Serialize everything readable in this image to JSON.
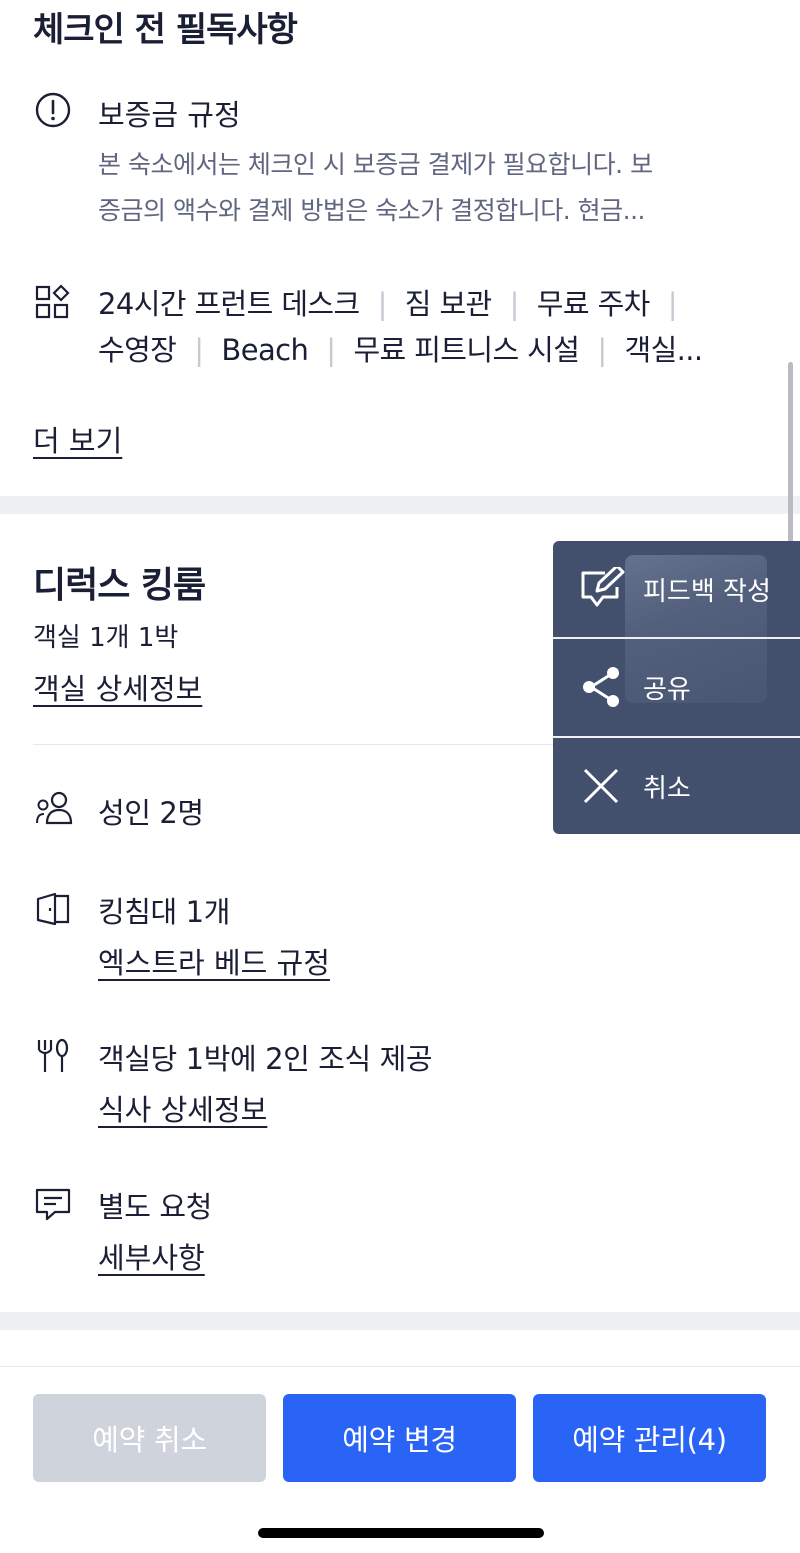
{
  "section": {
    "title": "체크인 전 필독사항"
  },
  "deposit": {
    "title": "보증금 규정",
    "desc_line1": "본 숙소에서는 체크인 시 보증금 결제가 필요합니다. 보",
    "desc_line2": "증금의 액수와 결제 방법은 숙소가 결정합니다. 현금..."
  },
  "amenities": {
    "line1": [
      "24시간 프런트 데스크",
      "짐 보관",
      "무료 주차"
    ],
    "line2": [
      "수영장",
      "Beach",
      "무료 피트니스 시설",
      "객실..."
    ],
    "separator": "|"
  },
  "more_link": "더 보기",
  "room": {
    "name": "디럭스 킹룸",
    "count": "객실 1개 1박",
    "detail_link": "객실 상세정보"
  },
  "details": {
    "guests": "성인 2명",
    "bed": "킹침대 1개",
    "extra_bed_link": "엑스트라 베드 규정",
    "meal": "객실당 1박에 2인 조식 제공",
    "meal_link": "식사 상세정보",
    "request": "별도 요청",
    "request_link": "세부사항"
  },
  "fab_menu": {
    "feedback": "피드백 작성",
    "share": "공유",
    "cancel": "취소",
    "icons": [
      "edit-feedback-icon",
      "share-icon",
      "close-icon"
    ]
  },
  "bottom": {
    "cancel_booking": "예약 취소",
    "change_booking": "예약 변경",
    "manage_booking": "예약 관리(4)"
  },
  "colors": {
    "primary": "#2a64f6",
    "disabled": "#cfd3dc",
    "menu_bg": "#42506e",
    "text": "#1a1f36",
    "muted": "#606680"
  }
}
